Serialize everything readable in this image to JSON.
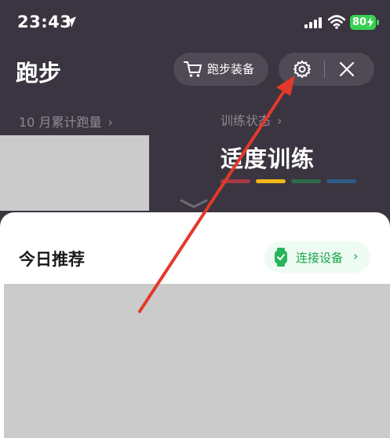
{
  "status_bar": {
    "time": "23:43",
    "battery": "80"
  },
  "header": {
    "title": "跑步",
    "gear_button_label": "跑步装备"
  },
  "stats": {
    "monthly_label": "10 月累计跑量",
    "training_label": "训练状态",
    "training_status": "适度训练",
    "status_colors": [
      "#a43a46",
      "#f3b71a",
      "#2f6b4a",
      "#2d5c85"
    ]
  },
  "recommend": {
    "title": "今日推荐",
    "connect_label": "连接设备"
  },
  "colors": {
    "background": "#3a3540",
    "accent_green": "#1aa34a",
    "battery_green": "#39d053",
    "annotation_red": "#e23a2a"
  },
  "icons": {
    "location": "location-arrow-icon",
    "signal": "cellular-signal-icon",
    "wifi": "wifi-icon",
    "cart": "cart-icon",
    "settings": "settings-gear-icon",
    "close": "close-icon",
    "watch": "smartwatch-icon"
  }
}
